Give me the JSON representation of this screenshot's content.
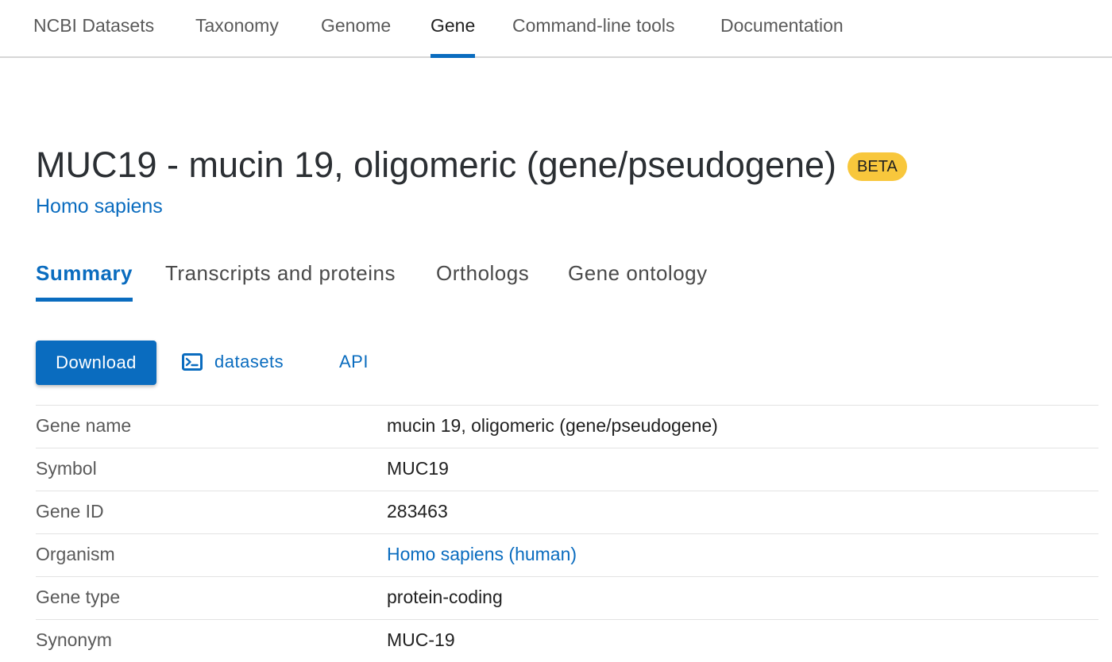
{
  "topnav": {
    "items": [
      {
        "label": "NCBI Datasets"
      },
      {
        "label": "Taxonomy"
      },
      {
        "label": "Genome"
      },
      {
        "label": "Gene"
      },
      {
        "label": "Command-line tools"
      },
      {
        "label": "Documentation"
      }
    ],
    "active": "Gene"
  },
  "header": {
    "title": "MUC19 - mucin 19, oligomeric (gene/pseudogene)",
    "badge": "BETA",
    "organism": "Homo sapiens"
  },
  "tabs": {
    "items": [
      {
        "label": "Summary"
      },
      {
        "label": "Transcripts and proteins"
      },
      {
        "label": "Orthologs"
      },
      {
        "label": "Gene ontology"
      }
    ],
    "active": "Summary"
  },
  "actions": {
    "download_label": "Download",
    "datasets_label": "datasets",
    "api_label": "API"
  },
  "summary": {
    "rows": [
      {
        "label": "Gene name",
        "value": "mucin 19, oligomeric (gene/pseudogene)"
      },
      {
        "label": "Symbol",
        "value": "MUC19"
      },
      {
        "label": "Gene ID",
        "value": "283463"
      },
      {
        "label": "Organism",
        "value": "Homo sapiens (human)"
      },
      {
        "label": "Gene type",
        "value": "protein-coding"
      },
      {
        "label": "Synonym",
        "value": "MUC-19"
      }
    ]
  },
  "colors": {
    "accent": "#0a6cbf",
    "badge": "#f8c73c"
  },
  "icons": {
    "datasets": "terminal-icon"
  }
}
